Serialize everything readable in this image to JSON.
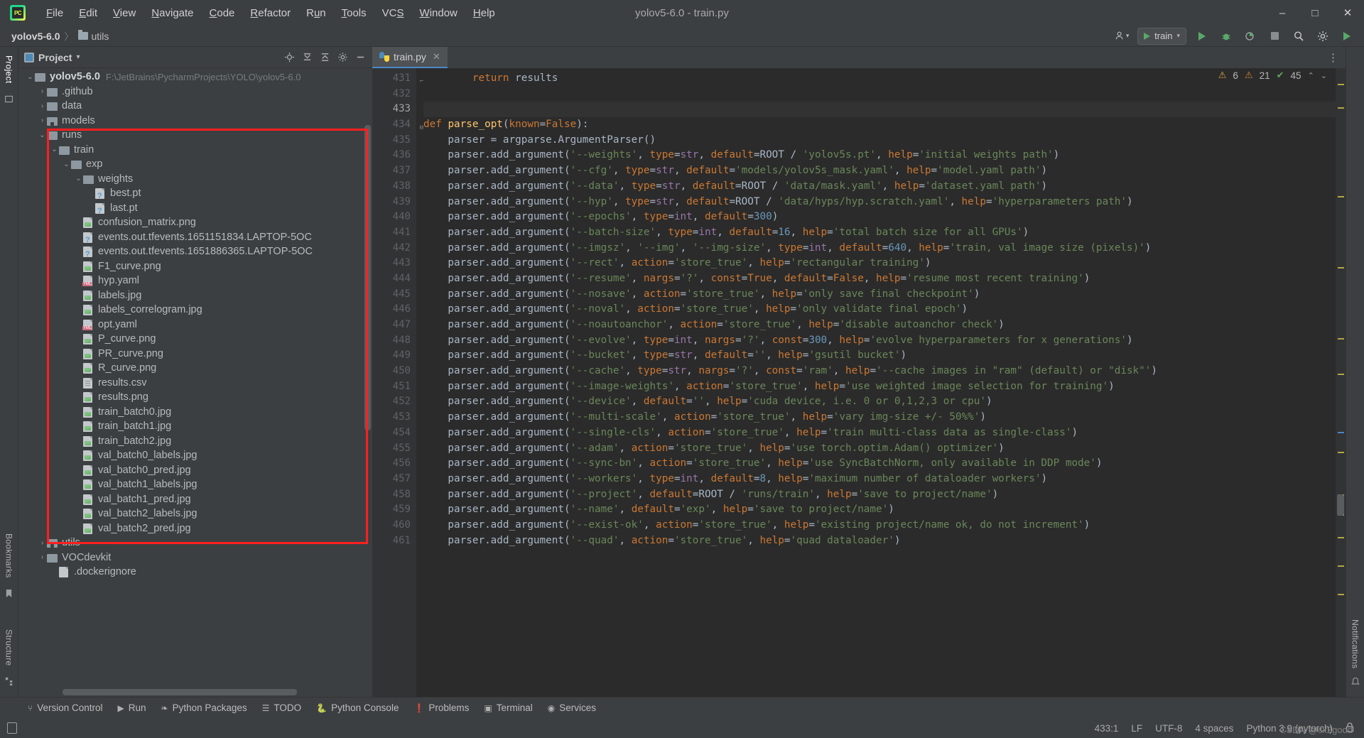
{
  "window": {
    "title": "yolov5-6.0 - train.py",
    "app_icon": "pycharm-logo-icon",
    "minimize": "–",
    "maximize": "□",
    "close": "✕"
  },
  "menubar": [
    {
      "label": "File",
      "mnemonic": "F"
    },
    {
      "label": "Edit",
      "mnemonic": "E"
    },
    {
      "label": "View",
      "mnemonic": "V"
    },
    {
      "label": "Navigate",
      "mnemonic": "N"
    },
    {
      "label": "Code",
      "mnemonic": "C"
    },
    {
      "label": "Refactor",
      "mnemonic": "R"
    },
    {
      "label": "Run",
      "mnemonic": "u"
    },
    {
      "label": "Tools",
      "mnemonic": "T"
    },
    {
      "label": "VCS",
      "mnemonic": "S"
    },
    {
      "label": "Window",
      "mnemonic": "W"
    },
    {
      "label": "Help",
      "mnemonic": "H"
    }
  ],
  "navbar": {
    "crumbs": [
      "yolov5-6.0",
      "utils"
    ],
    "separator": "〉",
    "run_config": "train",
    "user_icon": "account-icon",
    "run_icon": "run-icon",
    "debug_icon": "debug-icon",
    "coverage_icon": "run-with-coverage-icon",
    "stop_icon": "stop-icon",
    "search_icon": "search-everywhere-icon",
    "settings_icon": "settings-gear-icon",
    "updates_icon": "ide-update-icon"
  },
  "left_rail": {
    "tabs": [
      "Project",
      "Bookmarks",
      "Structure"
    ],
    "active": "Project"
  },
  "right_rail": {
    "tabs": [
      "Notifications"
    ]
  },
  "project_panel": {
    "title": "Project",
    "dropdown_caret": "▾",
    "tools": [
      "locate-icon",
      "expand-all-icon",
      "collapse-all-icon",
      "settings-icon",
      "hide-icon"
    ],
    "tree": [
      {
        "depth": 0,
        "twist": "v",
        "icon": "folder",
        "label": "yolov5-6.0",
        "bold": true,
        "sub": "F:\\JetBrains\\PycharmProjects\\YOLO\\yolov5-6.0"
      },
      {
        "depth": 1,
        "twist": ">",
        "icon": "folder",
        "label": ".github",
        "bold": false,
        "sub": ""
      },
      {
        "depth": 1,
        "twist": ">",
        "icon": "folder",
        "label": "data",
        "bold": false,
        "sub": ""
      },
      {
        "depth": 1,
        "twist": ">",
        "icon": "folder-src",
        "label": "models",
        "bold": false,
        "sub": ""
      },
      {
        "depth": 1,
        "twist": "v",
        "icon": "folder",
        "label": "runs",
        "bold": false,
        "sub": ""
      },
      {
        "depth": 2,
        "twist": "v",
        "icon": "folder",
        "label": "train",
        "bold": false,
        "sub": ""
      },
      {
        "depth": 3,
        "twist": "v",
        "icon": "folder",
        "label": "exp",
        "bold": false,
        "sub": ""
      },
      {
        "depth": 4,
        "twist": "v",
        "icon": "folder",
        "label": "weights",
        "bold": false,
        "sub": ""
      },
      {
        "depth": 5,
        "twist": "",
        "icon": "unknown",
        "label": "best.pt",
        "bold": false,
        "sub": ""
      },
      {
        "depth": 5,
        "twist": "",
        "icon": "unknown",
        "label": "last.pt",
        "bold": false,
        "sub": ""
      },
      {
        "depth": 4,
        "twist": "",
        "icon": "image",
        "label": "confusion_matrix.png",
        "bold": false,
        "sub": ""
      },
      {
        "depth": 4,
        "twist": "",
        "icon": "unknown",
        "label": "events.out.tfevents.1651151834.LAPTOP-5OC",
        "bold": false,
        "sub": ""
      },
      {
        "depth": 4,
        "twist": "",
        "icon": "unknown",
        "label": "events.out.tfevents.1651886365.LAPTOP-5OC",
        "bold": false,
        "sub": ""
      },
      {
        "depth": 4,
        "twist": "",
        "icon": "image",
        "label": "F1_curve.png",
        "bold": false,
        "sub": ""
      },
      {
        "depth": 4,
        "twist": "",
        "icon": "yml",
        "label": "hyp.yaml",
        "bold": false,
        "sub": ""
      },
      {
        "depth": 4,
        "twist": "",
        "icon": "image",
        "label": "labels.jpg",
        "bold": false,
        "sub": ""
      },
      {
        "depth": 4,
        "twist": "",
        "icon": "image",
        "label": "labels_correlogram.jpg",
        "bold": false,
        "sub": ""
      },
      {
        "depth": 4,
        "twist": "",
        "icon": "yml",
        "label": "opt.yaml",
        "bold": false,
        "sub": ""
      },
      {
        "depth": 4,
        "twist": "",
        "icon": "image",
        "label": "P_curve.png",
        "bold": false,
        "sub": ""
      },
      {
        "depth": 4,
        "twist": "",
        "icon": "image",
        "label": "PR_curve.png",
        "bold": false,
        "sub": ""
      },
      {
        "depth": 4,
        "twist": "",
        "icon": "image",
        "label": "R_curve.png",
        "bold": false,
        "sub": ""
      },
      {
        "depth": 4,
        "twist": "",
        "icon": "csv",
        "label": "results.csv",
        "bold": false,
        "sub": ""
      },
      {
        "depth": 4,
        "twist": "",
        "icon": "image",
        "label": "results.png",
        "bold": false,
        "sub": ""
      },
      {
        "depth": 4,
        "twist": "",
        "icon": "image",
        "label": "train_batch0.jpg",
        "bold": false,
        "sub": ""
      },
      {
        "depth": 4,
        "twist": "",
        "icon": "image",
        "label": "train_batch1.jpg",
        "bold": false,
        "sub": ""
      },
      {
        "depth": 4,
        "twist": "",
        "icon": "image",
        "label": "train_batch2.jpg",
        "bold": false,
        "sub": ""
      },
      {
        "depth": 4,
        "twist": "",
        "icon": "image",
        "label": "val_batch0_labels.jpg",
        "bold": false,
        "sub": ""
      },
      {
        "depth": 4,
        "twist": "",
        "icon": "image",
        "label": "val_batch0_pred.jpg",
        "bold": false,
        "sub": ""
      },
      {
        "depth": 4,
        "twist": "",
        "icon": "image",
        "label": "val_batch1_labels.jpg",
        "bold": false,
        "sub": ""
      },
      {
        "depth": 4,
        "twist": "",
        "icon": "image",
        "label": "val_batch1_pred.jpg",
        "bold": false,
        "sub": ""
      },
      {
        "depth": 4,
        "twist": "",
        "icon": "image",
        "label": "val_batch2_labels.jpg",
        "bold": false,
        "sub": ""
      },
      {
        "depth": 4,
        "twist": "",
        "icon": "image",
        "label": "val_batch2_pred.jpg",
        "bold": false,
        "sub": ""
      },
      {
        "depth": 1,
        "twist": ">",
        "icon": "folder-src",
        "label": "utils",
        "bold": false,
        "sub": ""
      },
      {
        "depth": 1,
        "twist": ">",
        "icon": "folder",
        "label": "VOCdevkit",
        "bold": false,
        "sub": ""
      },
      {
        "depth": 2,
        "twist": "",
        "icon": "file",
        "label": ".dockerignore",
        "bold": false,
        "sub": ""
      }
    ]
  },
  "editor": {
    "tab": {
      "label": "train.py",
      "icon": "python-file-icon",
      "close": "✕"
    },
    "inspections": {
      "warnings": "6",
      "weak_warnings": "21",
      "ok_count": "45",
      "up_chevron": "⌃",
      "down_chevron": "⌄"
    },
    "first_line_number": 431,
    "caret_line": 433,
    "lines": [
      {
        "n": 431,
        "text": "        return results",
        "fold": "end"
      },
      {
        "n": 432,
        "text": ""
      },
      {
        "n": 433,
        "text": ""
      },
      {
        "n": 434,
        "text": "def parse_opt(known=False):",
        "fold": "start"
      },
      {
        "n": 435,
        "text": "    parser = argparse.ArgumentParser()"
      },
      {
        "n": 436,
        "text": "    parser.add_argument('--weights', type=str, default=ROOT / 'yolov5s.pt', help='initial weights path')"
      },
      {
        "n": 437,
        "text": "    parser.add_argument('--cfg', type=str, default='models/yolov5s_mask.yaml', help='model.yaml path')"
      },
      {
        "n": 438,
        "text": "    parser.add_argument('--data', type=str, default=ROOT / 'data/mask.yaml', help='dataset.yaml path')"
      },
      {
        "n": 439,
        "text": "    parser.add_argument('--hyp', type=str, default=ROOT / 'data/hyps/hyp.scratch.yaml', help='hyperparameters path')"
      },
      {
        "n": 440,
        "text": "    parser.add_argument('--epochs', type=int, default=300)"
      },
      {
        "n": 441,
        "text": "    parser.add_argument('--batch-size', type=int, default=16, help='total batch size for all GPUs')"
      },
      {
        "n": 442,
        "text": "    parser.add_argument('--imgsz', '--img', '--img-size', type=int, default=640, help='train, val image size (pixels)')"
      },
      {
        "n": 443,
        "text": "    parser.add_argument('--rect', action='store_true', help='rectangular training')"
      },
      {
        "n": 444,
        "text": "    parser.add_argument('--resume', nargs='?', const=True, default=False, help='resume most recent training')"
      },
      {
        "n": 445,
        "text": "    parser.add_argument('--nosave', action='store_true', help='only save final checkpoint')"
      },
      {
        "n": 446,
        "text": "    parser.add_argument('--noval', action='store_true', help='only validate final epoch')"
      },
      {
        "n": 447,
        "text": "    parser.add_argument('--noautoanchor', action='store_true', help='disable autoanchor check')"
      },
      {
        "n": 448,
        "text": "    parser.add_argument('--evolve', type=int, nargs='?', const=300, help='evolve hyperparameters for x generations')"
      },
      {
        "n": 449,
        "text": "    parser.add_argument('--bucket', type=str, default='', help='gsutil bucket')"
      },
      {
        "n": 450,
        "text": "    parser.add_argument('--cache', type=str, nargs='?', const='ram', help='--cache images in \"ram\" (default) or \"disk\"')"
      },
      {
        "n": 451,
        "text": "    parser.add_argument('--image-weights', action='store_true', help='use weighted image selection for training')"
      },
      {
        "n": 452,
        "text": "    parser.add_argument('--device', default='', help='cuda device, i.e. 0 or 0,1,2,3 or cpu')"
      },
      {
        "n": 453,
        "text": "    parser.add_argument('--multi-scale', action='store_true', help='vary img-size +/- 50%%')"
      },
      {
        "n": 454,
        "text": "    parser.add_argument('--single-cls', action='store_true', help='train multi-class data as single-class')"
      },
      {
        "n": 455,
        "text": "    parser.add_argument('--adam', action='store_true', help='use torch.optim.Adam() optimizer')"
      },
      {
        "n": 456,
        "text": "    parser.add_argument('--sync-bn', action='store_true', help='use SyncBatchNorm, only available in DDP mode')"
      },
      {
        "n": 457,
        "text": "    parser.add_argument('--workers', type=int, default=8, help='maximum number of dataloader workers')"
      },
      {
        "n": 458,
        "text": "    parser.add_argument('--project', default=ROOT / 'runs/train', help='save to project/name')"
      },
      {
        "n": 459,
        "text": "    parser.add_argument('--name', default='exp', help='save to project/name')"
      },
      {
        "n": 460,
        "text": "    parser.add_argument('--exist-ok', action='store_true', help='existing project/name ok, do not increment')"
      },
      {
        "n": 461,
        "text": "    parser.add_argument('--quad', action='store_true', help='quad dataloader')"
      }
    ]
  },
  "bottom_tools": [
    {
      "label": "Version Control",
      "icon": "branch-icon"
    },
    {
      "label": "Run",
      "icon": "run-icon"
    },
    {
      "label": "Python Packages",
      "icon": "packages-icon"
    },
    {
      "label": "TODO",
      "icon": "todo-list-icon"
    },
    {
      "label": "Python Console",
      "icon": "python-console-icon"
    },
    {
      "label": "Problems",
      "icon": "problems-icon"
    },
    {
      "label": "Terminal",
      "icon": "terminal-icon"
    },
    {
      "label": "Services",
      "icon": "services-icon"
    }
  ],
  "statusbar": {
    "left_icon": "toggle-toolwindow-icon",
    "caret_position": "433:1",
    "line_separator": "LF",
    "encoding": "UTF-8",
    "indent": "4 spaces",
    "interpreter": "Python 3.9 (pytorch)",
    "lock_icon": "read-only-lock-icon",
    "watermark": "CSDN @cx2good"
  },
  "colors": {
    "accent_blue": "#4a88c7",
    "annotation_red": "#ff1f1f",
    "keyword_orange": "#cc7832",
    "string_green": "#6a8759",
    "number_blue": "#6897bb",
    "function_yellow": "#ffc66d",
    "panel_bg": "#3c3f41",
    "editor_bg": "#2b2b2b"
  }
}
